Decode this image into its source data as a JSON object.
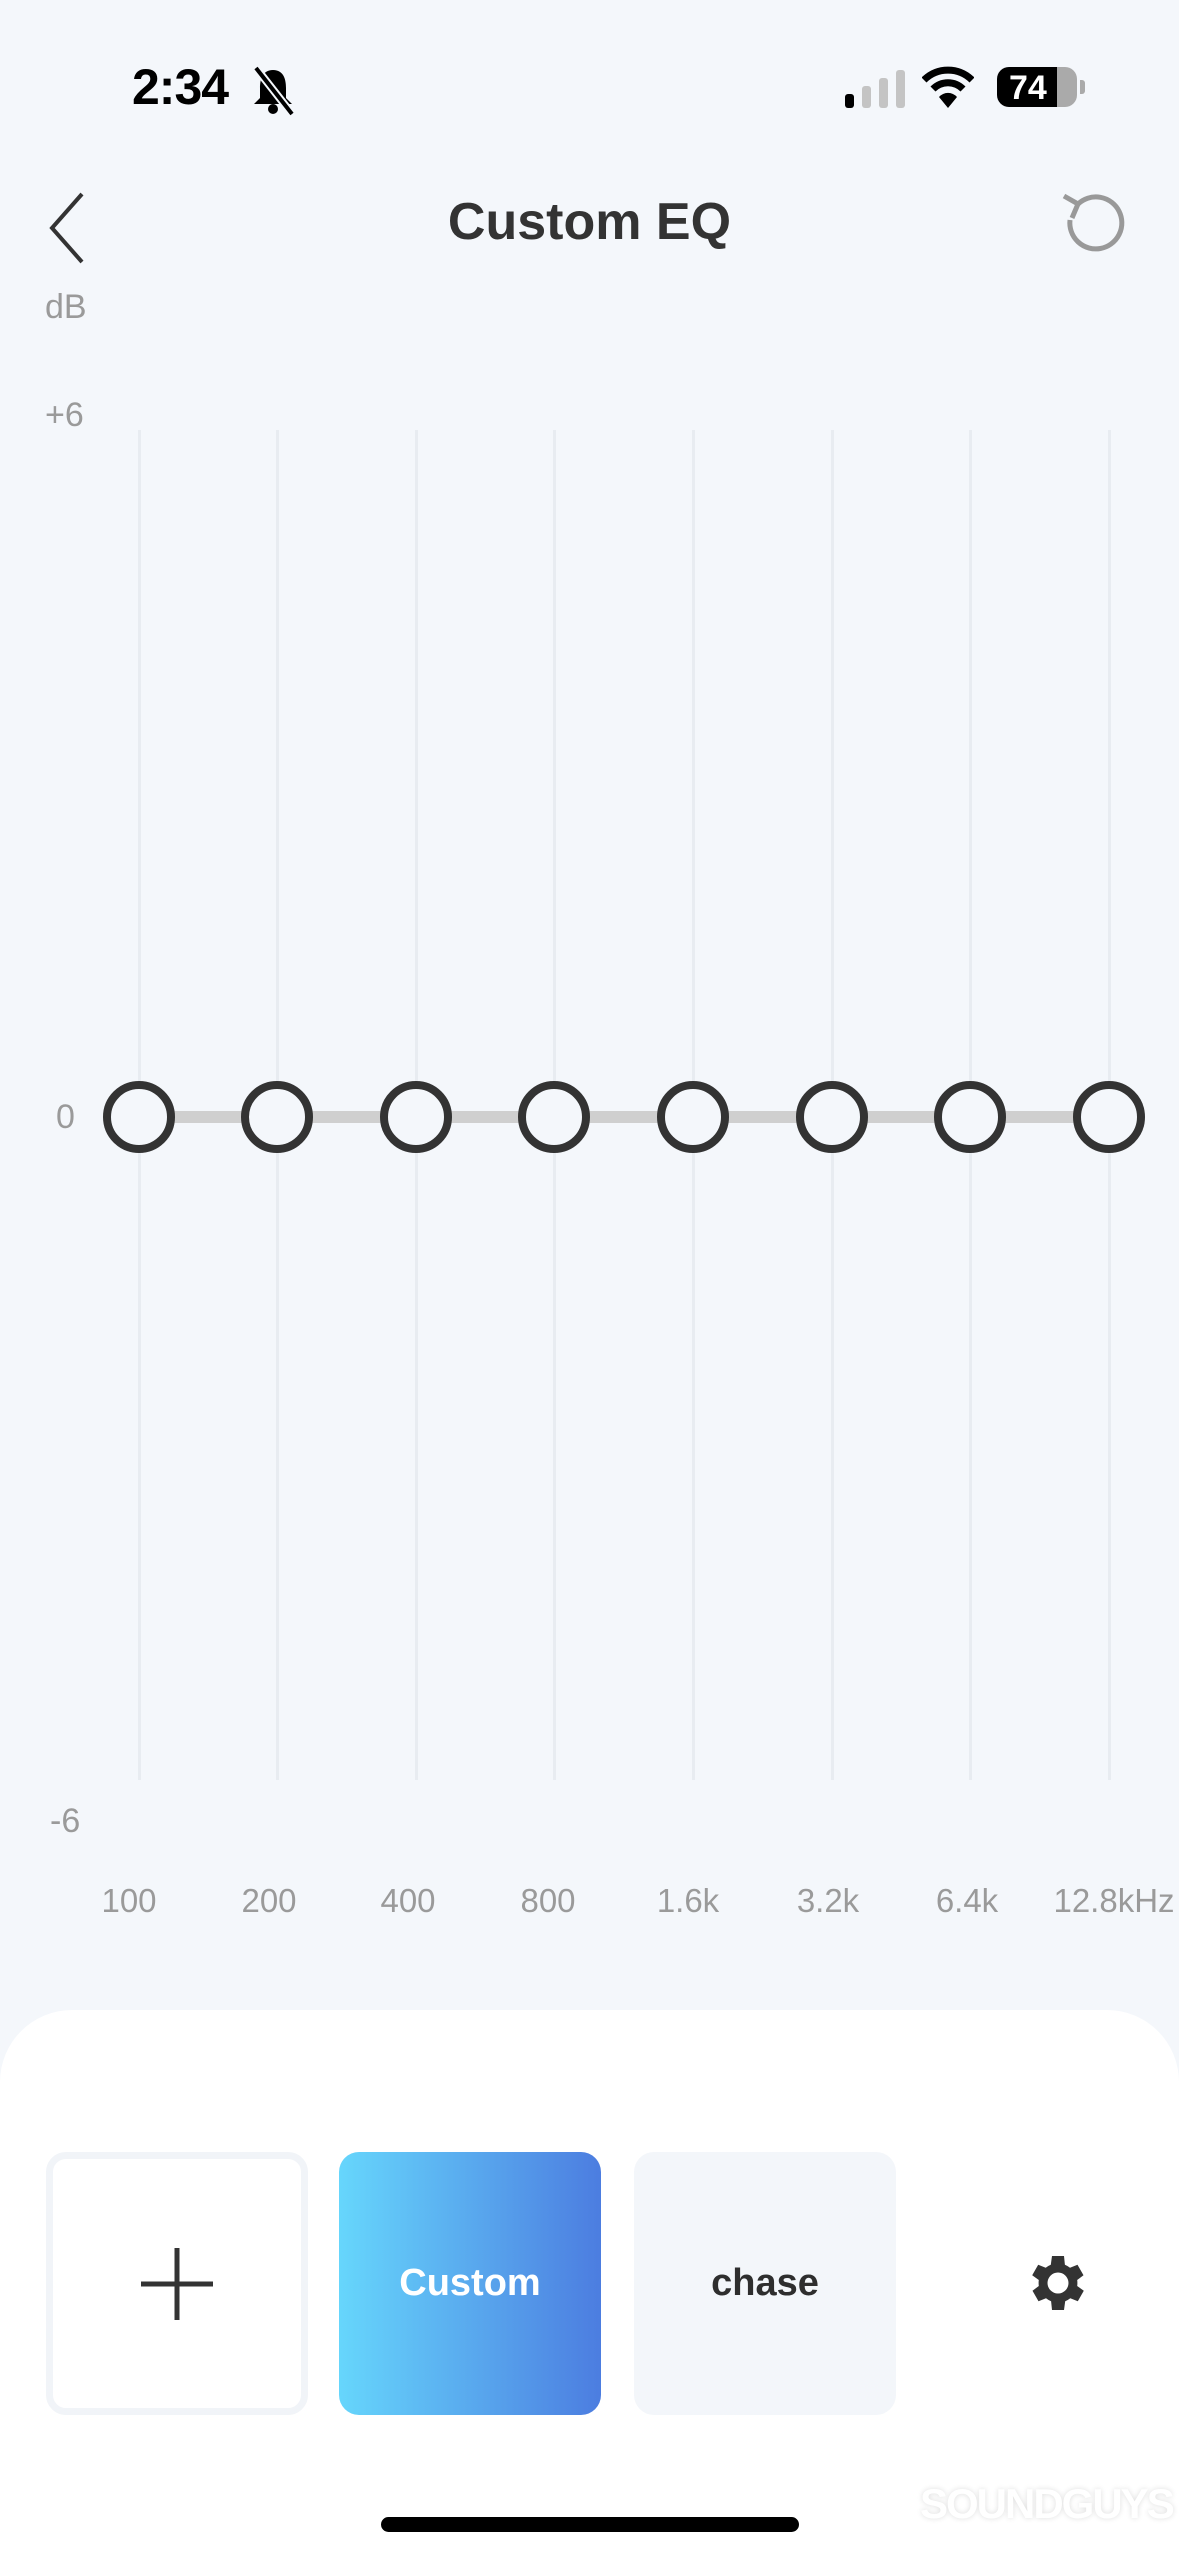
{
  "status_bar": {
    "time": "2:34",
    "battery": "74",
    "silent_icon": "bell-slash-icon",
    "signal_bars_active": 1,
    "signal_bars_total": 4
  },
  "header": {
    "title": "Custom EQ",
    "back_icon": "chevron-left-icon",
    "reset_icon": "reset-icon"
  },
  "eq": {
    "unit_label": "dB",
    "y_ticks": [
      "+6",
      "0",
      "-6"
    ],
    "ylim": [
      -6,
      6
    ],
    "bands": [
      {
        "label": "100",
        "gain": 0
      },
      {
        "label": "200",
        "gain": 0
      },
      {
        "label": "400",
        "gain": 0
      },
      {
        "label": "800",
        "gain": 0
      },
      {
        "label": "1.6k",
        "gain": 0
      },
      {
        "label": "3.2k",
        "gain": 0
      },
      {
        "label": "6.4k",
        "gain": 0
      },
      {
        "label": "12.8kHz",
        "gain": 0
      }
    ]
  },
  "presets": {
    "add_icon": "plus-icon",
    "items": [
      {
        "label": "Custom",
        "selected": true
      },
      {
        "label": "chase",
        "selected": false
      }
    ],
    "settings_icon": "gear-icon",
    "accent_gradient": [
      "#66d6fc",
      "#4c7de0"
    ]
  },
  "watermark": "SOUNDGUYS"
}
